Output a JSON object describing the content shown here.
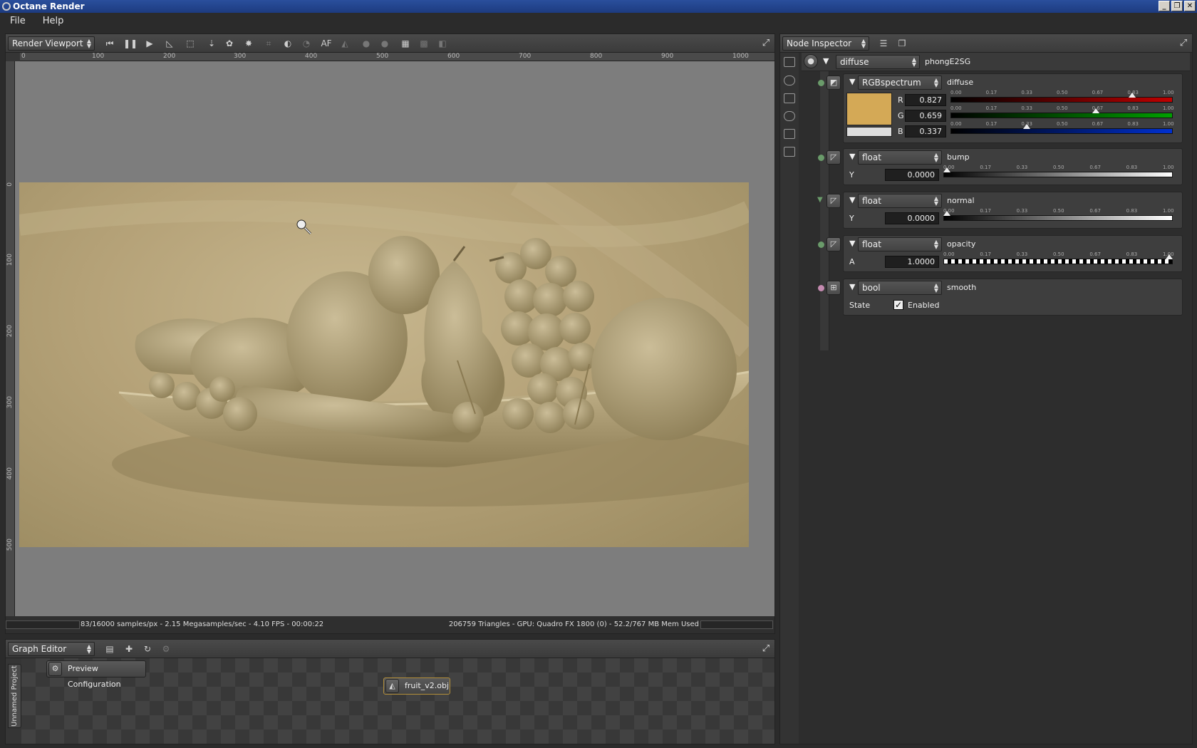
{
  "window": {
    "title": "Octane Render",
    "controls": [
      "minimize",
      "restore",
      "close"
    ]
  },
  "menu": [
    "File",
    "Help"
  ],
  "viewport": {
    "mode": "Render Viewport",
    "ruler_x": [
      "0",
      "100",
      "200",
      "300",
      "400",
      "500",
      "600",
      "700",
      "800",
      "900",
      "1000"
    ],
    "ruler_y": [
      "0",
      "100",
      "200",
      "300",
      "400",
      "500"
    ],
    "status_left": "83/16000 samples/px - 2.15 Megasamples/sec - 4.10 FPS - 00:00:22",
    "status_right": "206759 Triangles - GPU: Quadro FX 1800 (0) - 52.2/767 MB Mem Used",
    "af_label": "AF"
  },
  "graph_editor": {
    "mode": "Graph Editor",
    "tab": "Unnamed Project",
    "nodes": [
      "Preview Configuration",
      "fruit_v2.obj"
    ]
  },
  "inspector": {
    "mode": "Node Inspector",
    "root": {
      "type": "diffuse",
      "name": "phongE2SG"
    },
    "diffuse": {
      "type": "RGBspectrum",
      "name": "diffuse",
      "swatch_color": "#d4a956",
      "channels": [
        {
          "label": "R",
          "value": "0.827",
          "fraction": 0.827,
          "color": "#c00000"
        },
        {
          "label": "G",
          "value": "0.659",
          "fraction": 0.659,
          "color": "#00a000"
        },
        {
          "label": "B",
          "value": "0.337",
          "fraction": 0.337,
          "color": "#0030d0"
        }
      ]
    },
    "ticks": [
      "0.00",
      "0.17",
      "0.33",
      "0.50",
      "0.67",
      "0.83",
      "1.00"
    ],
    "bump": {
      "type": "float",
      "name": "bump",
      "label": "Y",
      "value": "0.0000",
      "fraction": 0.0
    },
    "normal": {
      "type": "float",
      "name": "normal",
      "label": "Y",
      "value": "0.0000",
      "fraction": 0.0
    },
    "opacity": {
      "type": "float",
      "name": "opacity",
      "label": "A",
      "value": "1.0000",
      "fraction": 1.0
    },
    "smooth": {
      "type": "bool",
      "name": "smooth",
      "label": "State",
      "checkbox_label": "Enabled",
      "checked": true
    }
  }
}
